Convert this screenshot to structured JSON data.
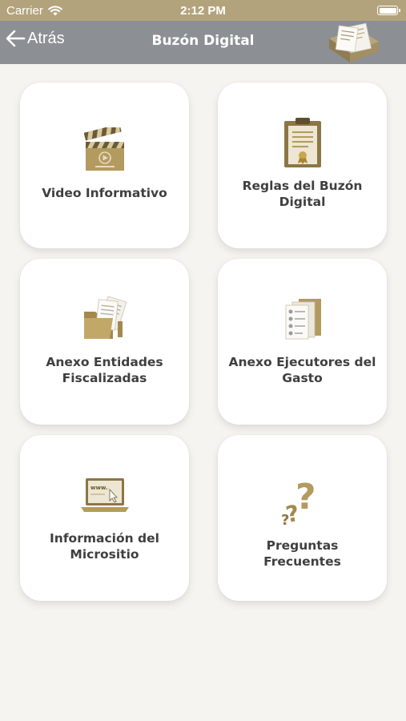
{
  "status": {
    "carrier": "Carrier",
    "time": "2:12 PM"
  },
  "nav": {
    "back_label": "Atrás",
    "title": "Buzón Digital"
  },
  "menu": [
    {
      "label": "Video Informativo",
      "icon": "clapperboard-icon"
    },
    {
      "label": "Reglas del Buzón Digital",
      "icon": "certificate-clipboard-icon"
    },
    {
      "label": "Anexo Entidades Fiscalizadas",
      "icon": "folder-documents-icon"
    },
    {
      "label": "Anexo Ejecutores del Gasto",
      "icon": "documents-stack-icon"
    },
    {
      "label": "Información del Micrositio",
      "icon": "laptop-www-icon"
    },
    {
      "label": "Preguntas Frecuentes",
      "icon": "question-marks-icon"
    }
  ],
  "colors": {
    "accent": "#b3a37c",
    "nav": "#8c8f94",
    "background": "#f6f4f0",
    "card": "#ffffff",
    "text": "#3f3f3f"
  }
}
